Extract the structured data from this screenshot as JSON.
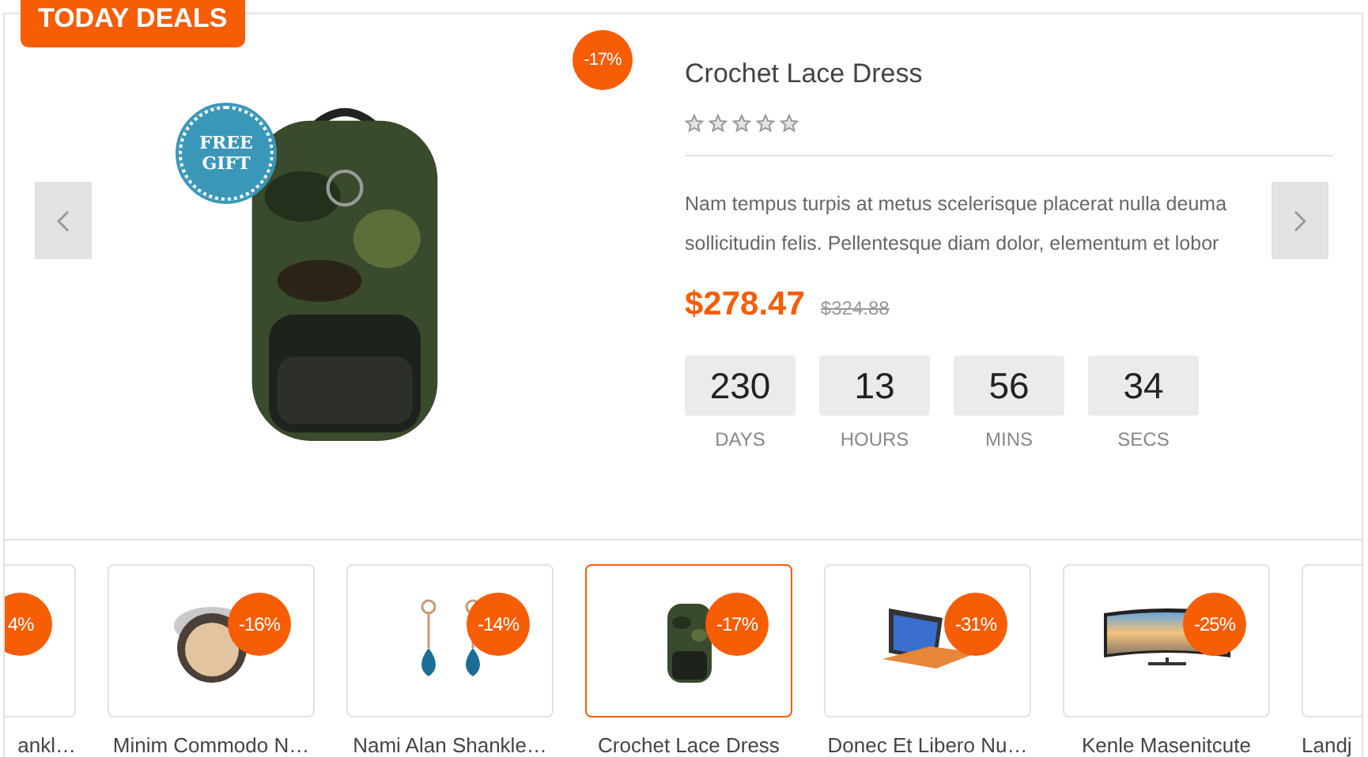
{
  "ribbon": "TODAY DEALS",
  "product": {
    "discount": "-17%",
    "gift": "FREE GIFT",
    "name": "Crochet Lace Dress",
    "stars": 0,
    "description": "Nam tempus turpis at metus scelerisque placerat nulla deuma sollicitudin felis. Pellentesque diam dolor, elementum et lobor",
    "price": "$278.47",
    "old_price": "$324.88"
  },
  "countdown": [
    {
      "value": "230",
      "unit": "DAYS"
    },
    {
      "value": "13",
      "unit": "HOURS"
    },
    {
      "value": "56",
      "unit": "MINS"
    },
    {
      "value": "34",
      "unit": "SECS"
    }
  ],
  "thumbnails": [
    {
      "name": "ankl…",
      "discount": "4%",
      "kind": "none",
      "selected": false
    },
    {
      "name": "Minim Commodo N…",
      "discount": "-16%",
      "kind": "compact",
      "selected": false
    },
    {
      "name": "Nami Alan Shankle…",
      "discount": "-14%",
      "kind": "earrings",
      "selected": false
    },
    {
      "name": "Crochet Lace Dress",
      "discount": "-17%",
      "kind": "backpack",
      "selected": true
    },
    {
      "name": "Donec Et Libero Nu…",
      "discount": "-31%",
      "kind": "laptop",
      "selected": false
    },
    {
      "name": "Kenle Masenitcute",
      "discount": "-25%",
      "kind": "tv",
      "selected": false
    },
    {
      "name": "Landj",
      "kind": "none",
      "selected": false
    }
  ]
}
